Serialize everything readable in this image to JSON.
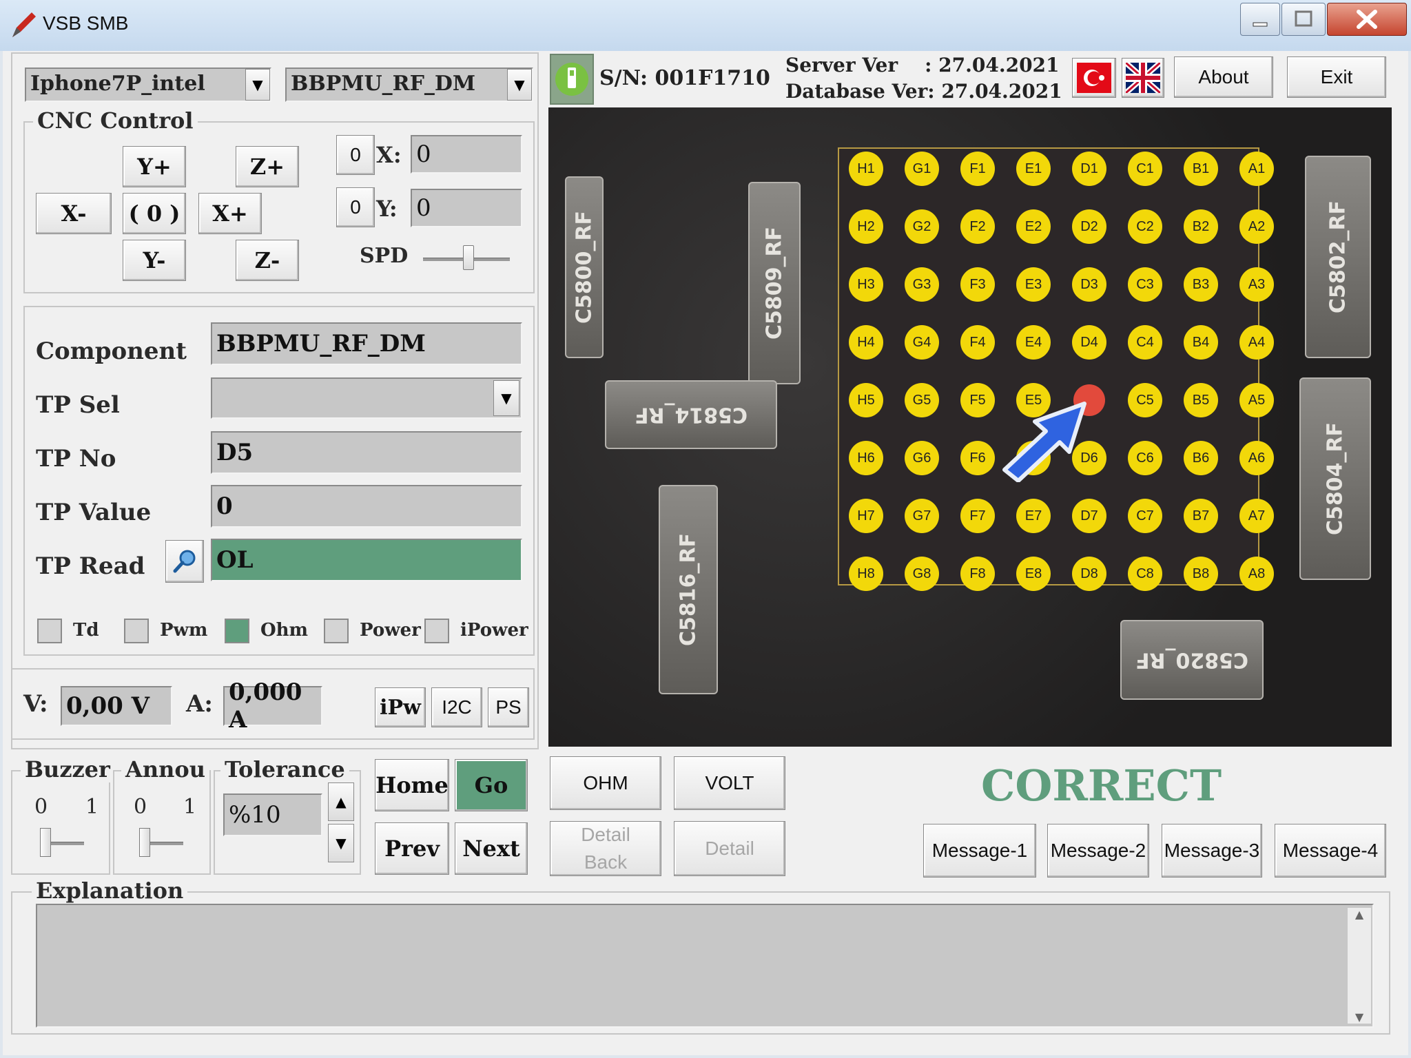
{
  "window": {
    "title": "VSB SMB"
  },
  "selectors": {
    "model": "Iphone7P_intel",
    "component": "BBPMU_RF_DM"
  },
  "header": {
    "serial": "S/N: 001F1710",
    "server_ver": "Server Ver    : 27.04.2021",
    "database_ver": "Database Ver: 27.04.2021",
    "about_label": "About",
    "exit_label": "Exit"
  },
  "cnc": {
    "title": "CNC Control",
    "y_plus": "Y+",
    "y_minus": "Y-",
    "z_plus": "Z+",
    "z_minus": "Z-",
    "x_plus": "X+",
    "x_minus": "X-",
    "home": "( 0 )",
    "x_reset": "0",
    "y_reset": "0",
    "x_label": "X:",
    "y_label": "Y:",
    "x_value": "0",
    "y_value": "0",
    "spd_label": "SPD"
  },
  "info": {
    "component_label": "Component",
    "component_value": "BBPMU_RF_DM",
    "tp_sel_label": "TP Sel",
    "tp_sel_value": "",
    "tp_no_label": "TP No",
    "tp_no_value": "D5",
    "tp_value_label": "TP Value",
    "tp_value_value": "0",
    "tp_read_label": "TP Read",
    "tp_read_value": "OL"
  },
  "modes": [
    {
      "label": "Td",
      "checked": false
    },
    {
      "label": "Pwm",
      "checked": false
    },
    {
      "label": "Ohm",
      "checked": true
    },
    {
      "label": "Power",
      "checked": false
    },
    {
      "label": "iPower",
      "checked": false
    }
  ],
  "power": {
    "v_label": "V:",
    "v_value": "0,00 V",
    "a_label": "A:",
    "a_value": "0,000 A",
    "ipw": "iPw",
    "i2c": "I2C",
    "ps": "PS"
  },
  "settings": {
    "buzzer_label": "Buzzer",
    "buzzer_min": "0",
    "buzzer_max": "1",
    "annou_label": "Annou",
    "annou_min": "0",
    "annou_max": "1",
    "tolerance_label": "Tolerance",
    "tolerance_value": "%10"
  },
  "nav": {
    "home": "Home",
    "go": "Go",
    "prev": "Prev",
    "next": "Next"
  },
  "measure": {
    "ohm": "OHM",
    "volt": "VOLT",
    "detail_back_1": "Detail",
    "detail_back_2": "Back",
    "detail": "Detail"
  },
  "result": {
    "status": "CORRECT"
  },
  "messages": [
    "Message-1",
    "Message-2",
    "Message-3",
    "Message-4"
  ],
  "explanation": {
    "title": "Explanation",
    "text": ""
  },
  "pcb": {
    "columns": [
      "H",
      "G",
      "F",
      "E",
      "D",
      "C",
      "B",
      "A"
    ],
    "rows": [
      "1",
      "2",
      "3",
      "4",
      "5",
      "6",
      "7",
      "8"
    ],
    "selected": "D5",
    "components": [
      "C5800_RF",
      "C5809_RF",
      "C5814_RF",
      "C5816_RF",
      "C5802_RF",
      "C5804_RF",
      "C5820_RF"
    ]
  },
  "colors": {
    "accent_green": "#5f9e7d",
    "pad_yellow": "#f2d80a",
    "probe_red": "#e24a3c"
  }
}
